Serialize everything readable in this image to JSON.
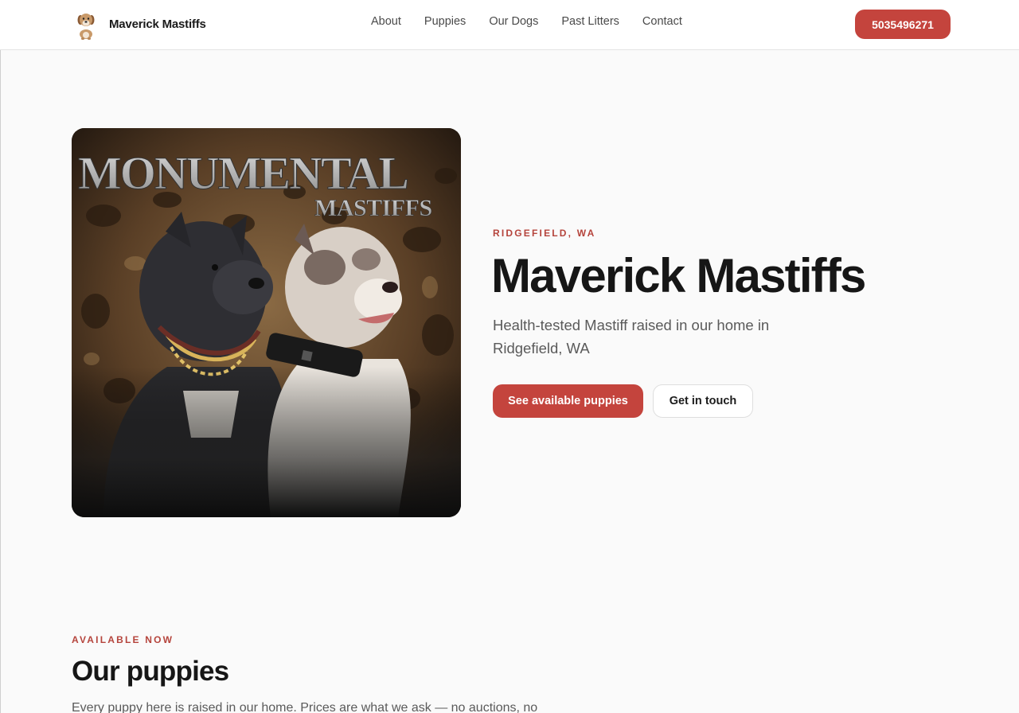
{
  "nav": {
    "brand_name": "Maverick Mastiffs",
    "links": [
      {
        "label": "About"
      },
      {
        "label": "Puppies"
      },
      {
        "label": "Our Dogs"
      },
      {
        "label": "Past Litters"
      },
      {
        "label": "Contact"
      }
    ],
    "phone_label": "5035496271"
  },
  "hero": {
    "image": {
      "logo_text_main": "MONUMENTAL",
      "logo_text_sub": "MASTIFFS"
    },
    "eyebrow": "RIDGEFIELD, WA",
    "title": "Maverick Mastiffs",
    "subtitle": "Health-tested Mastiff raised in our home in Ridgefield, WA",
    "primary_cta": "See available puppies",
    "secondary_cta": "Get in touch"
  },
  "puppies": {
    "eyebrow": "AVAILABLE NOW",
    "title": "Our puppies",
    "description": "Every puppy here is raised in our home. Prices are what we ask — no auctions, no"
  },
  "colors": {
    "accent": "#c4443d",
    "eyebrow": "#b5443c",
    "background": "#fafafa"
  }
}
